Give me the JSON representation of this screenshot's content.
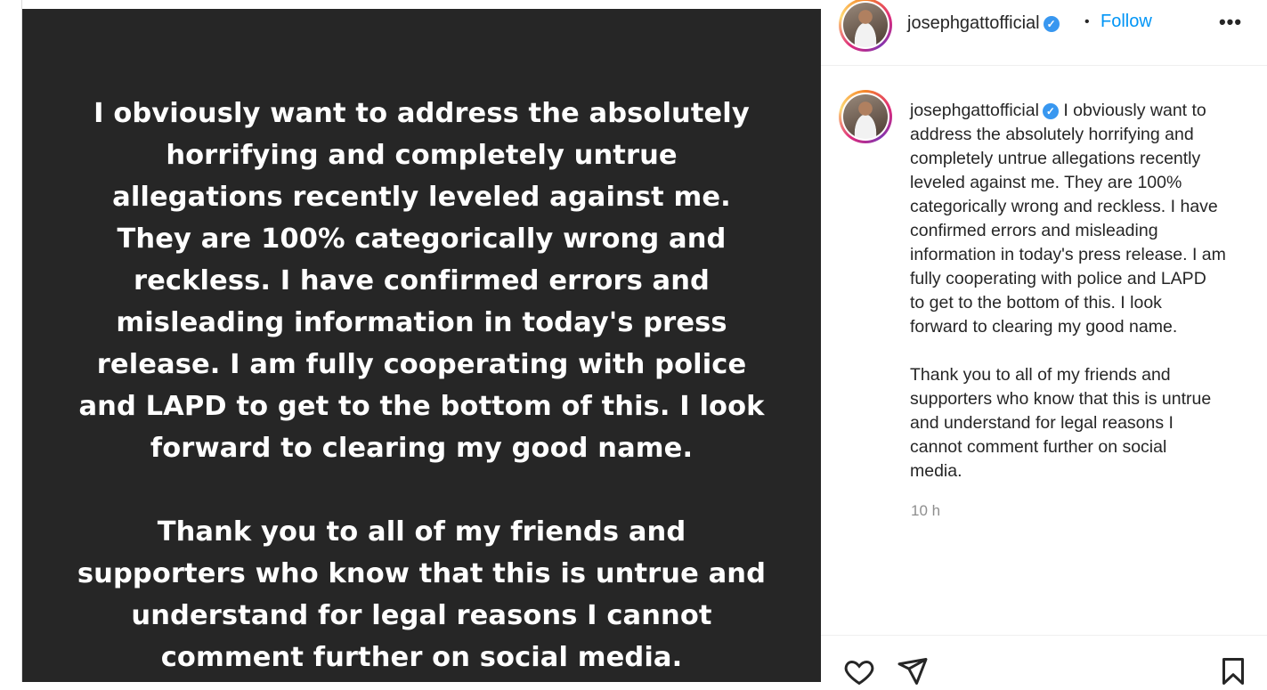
{
  "post": {
    "username": "josephgattofficial",
    "verified": true,
    "separator": "•",
    "follow_label": "Follow",
    "more_label": "•••",
    "media_text": "I obviously want to address the absolutely\nhorrifying and completely untrue\nallegations recently leveled against me.\nThey are 100% categorically wrong and\nreckless. I have confirmed errors and\nmisleading information in today's press\nrelease.  I am fully cooperating with police\nand LAPD to get to the bottom of this. I look\nforward to clearing my good name.\n\nThank you to all of my friends and\nsupporters who know that this is untrue and\nunderstand for legal reasons I cannot\ncomment further on social media.",
    "caption": "I obviously want to\naddress the absolutely horrifying and\ncompletely untrue allegations recently\nleveled against me. They are 100%\ncategorically wrong and reckless. I have\nconfirmed errors and misleading\ninformation in today's press release. I am\nfully cooperating with police and LAPD\nto get to the bottom of this. I look\nforward to clearing my good name.\n\nThank you to all of my friends and\nsupporters who know that this is untrue\nand understand for legal reasons I\ncannot comment further on social\nmedia.",
    "timestamp": "10 h"
  },
  "icons": {
    "verified": "verified-badge-icon",
    "like": "heart-icon",
    "share": "paper-plane-icon",
    "save": "bookmark-icon"
  },
  "colors": {
    "media_bg": "#262626",
    "link": "#0095f6",
    "verified": "#3897f0",
    "muted": "#8e8e8e"
  }
}
